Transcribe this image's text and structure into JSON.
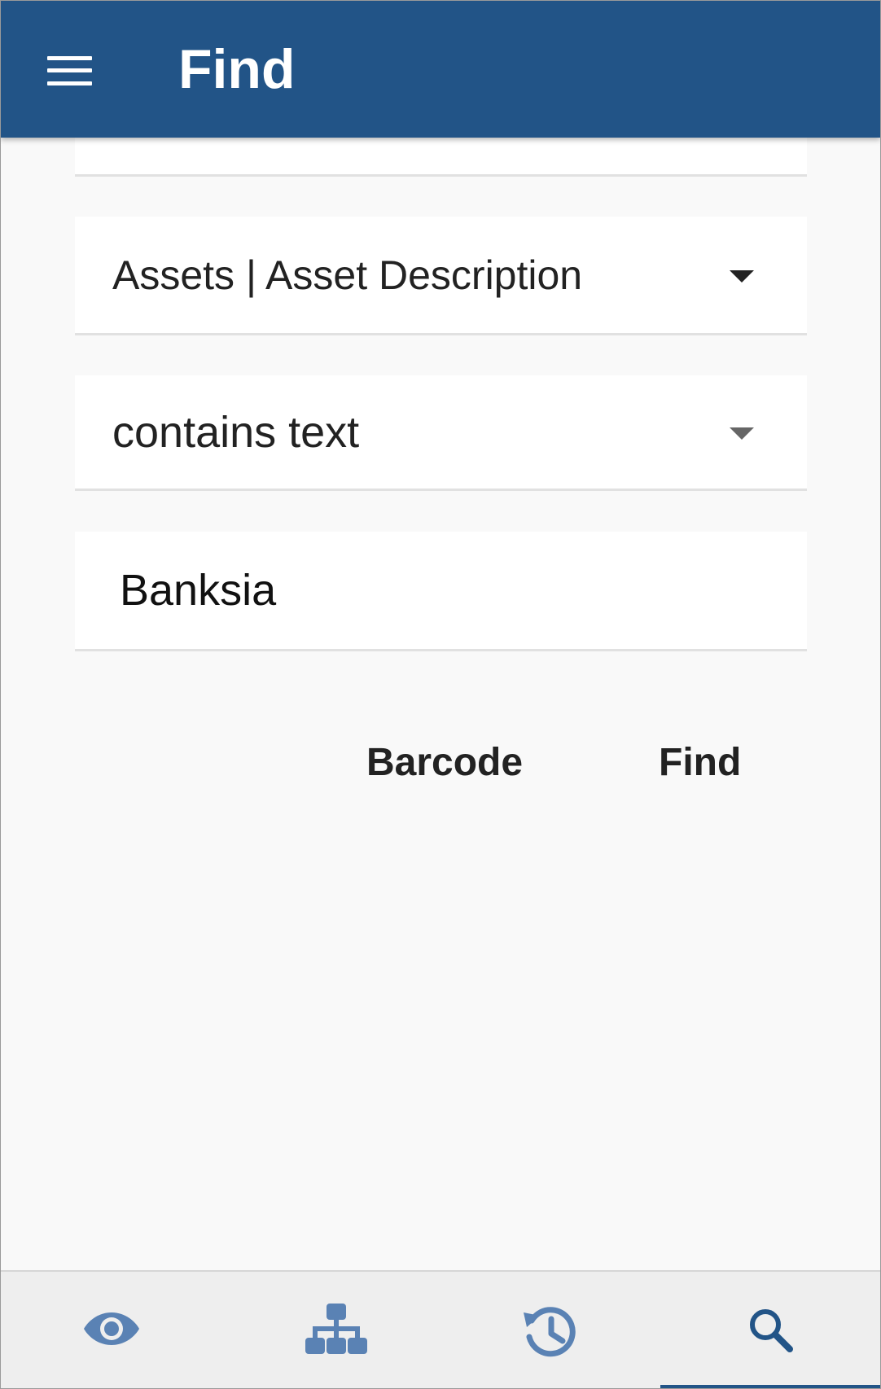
{
  "app_bar": {
    "title": "Find",
    "menu_icon": "hamburger-menu-icon"
  },
  "form": {
    "field_select": {
      "value": "Assets | Asset Description",
      "icon": "dropdown-arrow-icon"
    },
    "operator_select": {
      "value": "contains text",
      "icon": "dropdown-arrow-icon"
    },
    "search_input": {
      "value": "Banksia"
    }
  },
  "actions": {
    "barcode_label": "Barcode",
    "find_label": "Find"
  },
  "bottom_nav": {
    "tabs": [
      {
        "icon": "eye-icon",
        "active": false
      },
      {
        "icon": "hierarchy-icon",
        "active": false
      },
      {
        "icon": "history-icon",
        "active": false
      },
      {
        "icon": "search-icon",
        "active": true
      }
    ]
  },
  "colors": {
    "primary": "#225487",
    "nav_icon": "#5a82b4",
    "nav_icon_active": "#225487",
    "background": "#f9f9f9"
  }
}
